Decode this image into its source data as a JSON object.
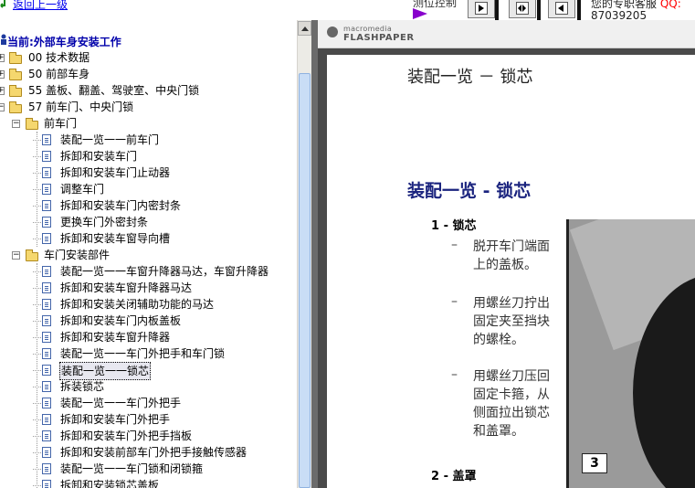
{
  "top": {
    "back_link": "返回上一级",
    "nav_info": "测位控制",
    "service": {
      "text": "您的专职客服",
      "qq": "QQ:",
      "number": "87039205"
    }
  },
  "tree": {
    "current": "当前:外部车身安装工作",
    "items": [
      {
        "label": "00 技术数据"
      },
      {
        "label": " 50 前部车身"
      },
      {
        "label": "55 盖板、翻盖、驾驶室、中央门锁"
      },
      {
        "label": "57 前车门、中央门锁"
      },
      {
        "label": "前车门"
      },
      {
        "label": "装配一览一一前车门"
      },
      {
        "label": "拆卸和安装车门"
      },
      {
        "label": "拆卸和安装车门止动器"
      },
      {
        "label": "调整车门"
      },
      {
        "label": "拆卸和安装车门内密封条"
      },
      {
        "label": "更换车门外密封条"
      },
      {
        "label": "拆卸和安装车窗导向槽"
      },
      {
        "label": "车门安装部件"
      },
      {
        "label": "装配一览一一车窗升降器马达，车窗升降器"
      },
      {
        "label": "拆卸和安装车窗升降器马达"
      },
      {
        "label": "拆卸和安装关闭辅助功能的马达"
      },
      {
        "label": "拆卸和安装车门内板盖板"
      },
      {
        "label": "拆卸和安装车窗升降器"
      },
      {
        "label": "装配一览一一车门外把手和车门锁"
      },
      {
        "label": "装配一览一一锁芯"
      },
      {
        "label": "拆装锁芯"
      },
      {
        "label": "装配一览一一车门外把手"
      },
      {
        "label": "拆卸和安装车门外把手"
      },
      {
        "label": "拆卸和安装车门外把手挡板"
      },
      {
        "label": "拆卸和安装前部车门外把手接触传感器"
      },
      {
        "label": "装配一览一一车门锁和闭锁箍"
      },
      {
        "label": "拆卸和安装锁芯盖板"
      }
    ]
  },
  "viewer": {
    "brand_top": "macromedia",
    "brand_bottom": "FLASHPAPER",
    "page_header": "装配一览 － 锁芯",
    "section_title": "装配一览 - 锁芯",
    "item1": "1 - 锁芯",
    "dash": "–",
    "step1": "脱开车门端面上的盖板。",
    "step2": "用螺丝刀拧出固定夹至挡块的螺栓。",
    "step3": "用螺丝刀压回固定卡箍，从侧面拉出锁芯和盖罩。",
    "item2": "2 - 盖罩",
    "photo_tag": "3"
  },
  "colors": {
    "accent": "#0000aa",
    "section_title": "#1a237e",
    "qq": "#ff0000",
    "splitter": "#6b6b6b"
  }
}
